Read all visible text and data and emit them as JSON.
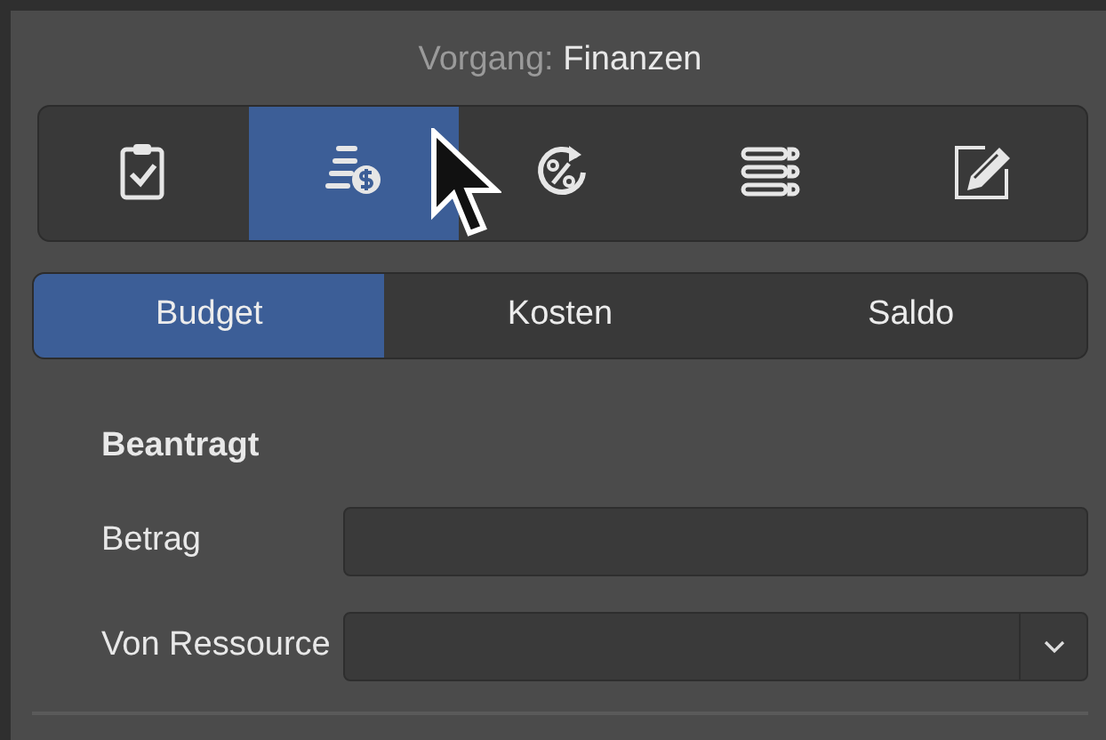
{
  "header": {
    "label": "Vorgang:",
    "value": "Finanzen"
  },
  "toolbar": [
    {
      "kind": "checklist",
      "selected": false
    },
    {
      "kind": "coins",
      "selected": true
    },
    {
      "kind": "percent",
      "selected": false
    },
    {
      "kind": "list",
      "selected": false
    },
    {
      "kind": "edit",
      "selected": false
    }
  ],
  "segments": [
    {
      "label": "Budget",
      "selected": true
    },
    {
      "label": "Kosten",
      "selected": false
    },
    {
      "label": "Saldo",
      "selected": false
    }
  ],
  "section": {
    "title": "Beantragt"
  },
  "fields": [
    {
      "label": "Betrag",
      "kind": "text"
    },
    {
      "label": "Von Ressource",
      "kind": "dropdown"
    }
  ]
}
